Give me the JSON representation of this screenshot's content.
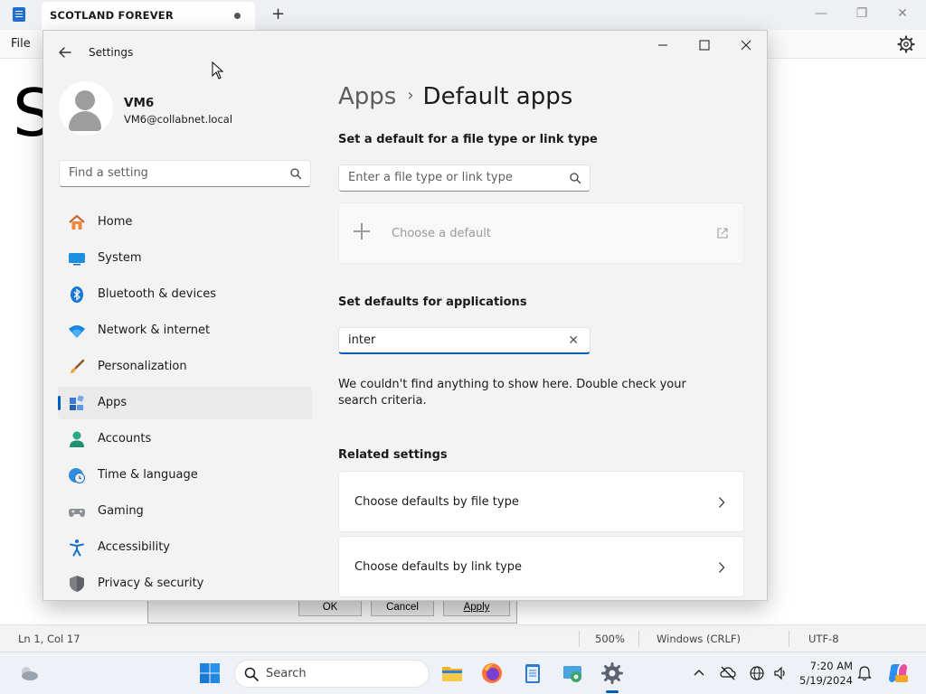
{
  "notepad": {
    "tab_title": "SCOTLAND FOREVER",
    "menu_file": "File",
    "editor_text": "S",
    "status": {
      "position": "Ln 1, Col 17",
      "zoom": "500%",
      "line_endings": "Windows (CRLF)",
      "encoding": "UTF-8"
    }
  },
  "dialog": {
    "ok": "OK",
    "cancel": "Cancel",
    "apply": "Apply"
  },
  "settings": {
    "window_title": "Settings",
    "user": {
      "name": "VM6",
      "email": "VM6@collabnet.local"
    },
    "find_placeholder": "Find a setting",
    "nav": [
      {
        "label": "Home",
        "icon": "home-icon"
      },
      {
        "label": "System",
        "icon": "system-icon"
      },
      {
        "label": "Bluetooth & devices",
        "icon": "bluetooth-icon"
      },
      {
        "label": "Network & internet",
        "icon": "wifi-icon"
      },
      {
        "label": "Personalization",
        "icon": "brush-icon"
      },
      {
        "label": "Apps",
        "icon": "apps-icon",
        "active": true
      },
      {
        "label": "Accounts",
        "icon": "accounts-icon"
      },
      {
        "label": "Time & language",
        "icon": "globe-clock-icon"
      },
      {
        "label": "Gaming",
        "icon": "gamepad-icon"
      },
      {
        "label": "Accessibility",
        "icon": "accessibility-icon"
      },
      {
        "label": "Privacy & security",
        "icon": "shield-icon"
      }
    ],
    "breadcrumb": {
      "parent": "Apps",
      "separator": "›",
      "current": "Default apps"
    },
    "filetype_section": {
      "heading": "Set a default for a file type or link type",
      "placeholder": "Enter a file type or link type",
      "choose_default": "Choose a default"
    },
    "apps_section": {
      "heading": "Set defaults for applications",
      "search_value": "inter",
      "no_results": "We couldn't find anything to show here. Double check your search criteria."
    },
    "related": {
      "heading": "Related settings",
      "items": [
        {
          "label": "Choose defaults by file type"
        },
        {
          "label": "Choose defaults by link type"
        }
      ]
    }
  },
  "taskbar": {
    "search_label": "Search",
    "time": "7:20 AM",
    "date": "5/19/2024"
  },
  "colors": {
    "accent": "#005fb8",
    "window_bg": "#f3f3f3",
    "taskbar_bg": "#eef1f6"
  }
}
